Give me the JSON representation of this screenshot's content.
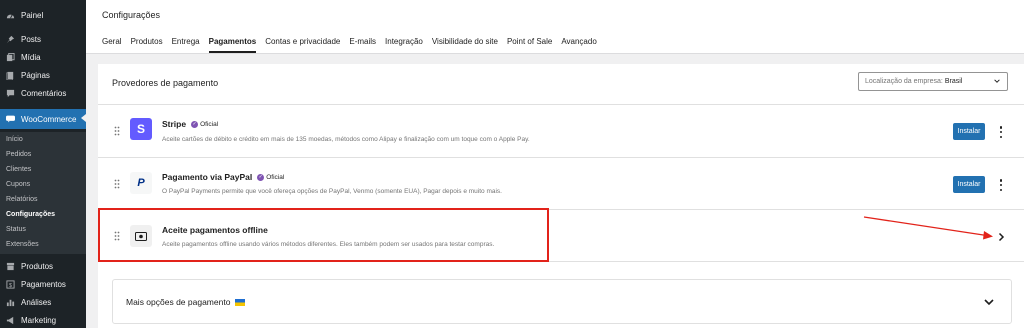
{
  "sidebar": {
    "items": [
      {
        "label": "Painel",
        "icon": "dashboard-icon"
      },
      {
        "label": "Posts",
        "icon": "pin-icon"
      },
      {
        "label": "Mídia",
        "icon": "media-icon"
      },
      {
        "label": "Páginas",
        "icon": "pages-icon"
      },
      {
        "label": "Comentários",
        "icon": "comments-icon"
      },
      {
        "label": "WooCommerce",
        "icon": "woo-icon"
      },
      {
        "label": "Produtos",
        "icon": "archive-icon"
      },
      {
        "label": "Pagamentos",
        "icon": "money-icon"
      },
      {
        "label": "Análises",
        "icon": "chart-icon"
      },
      {
        "label": "Marketing",
        "icon": "megaphone-icon"
      }
    ],
    "submenu": [
      "Início",
      "Pedidos",
      "Clientes",
      "Cupons",
      "Relatórios",
      "Configurações",
      "Status",
      "Extensões"
    ],
    "current_submenu": "Configurações",
    "active_color": "#2271b1"
  },
  "header": {
    "title": "Configurações",
    "tabs": [
      "Geral",
      "Produtos",
      "Entrega",
      "Pagamentos",
      "Contas e privacidade",
      "E-mails",
      "Integração",
      "Visibilidade do site",
      "Point of Sale",
      "Avançado"
    ],
    "active_tab": "Pagamentos"
  },
  "panel": {
    "title": "Provedores de pagamento",
    "location_label": "Localização da empresa:",
    "location_value": "Brasil"
  },
  "providers": [
    {
      "name": "Stripe",
      "badge": "Oficial",
      "description": "Aceite cartões de débito e crédito em mais de 135 moedas, métodos como Alipay e finalização com um toque com o Apple Pay.",
      "button": "Instalar",
      "logo_color": "#635bff"
    },
    {
      "name": "Pagamento via PayPal",
      "badge": "Oficial",
      "description": "O PayPal Payments permite que você ofereça opções de PayPal, Venmo (somente EUA), Pagar depois e muito mais.",
      "button": "Instalar",
      "logo_color": "#003087"
    },
    {
      "name": "Aceite pagamentos offline",
      "description": "Aceite pagamentos offline usando vários métodos diferentes. Eles também podem ser usados para testar compras."
    }
  ],
  "more_options": {
    "title": "Mais opções de pagamento"
  },
  "annotation_color": "#e2231a"
}
